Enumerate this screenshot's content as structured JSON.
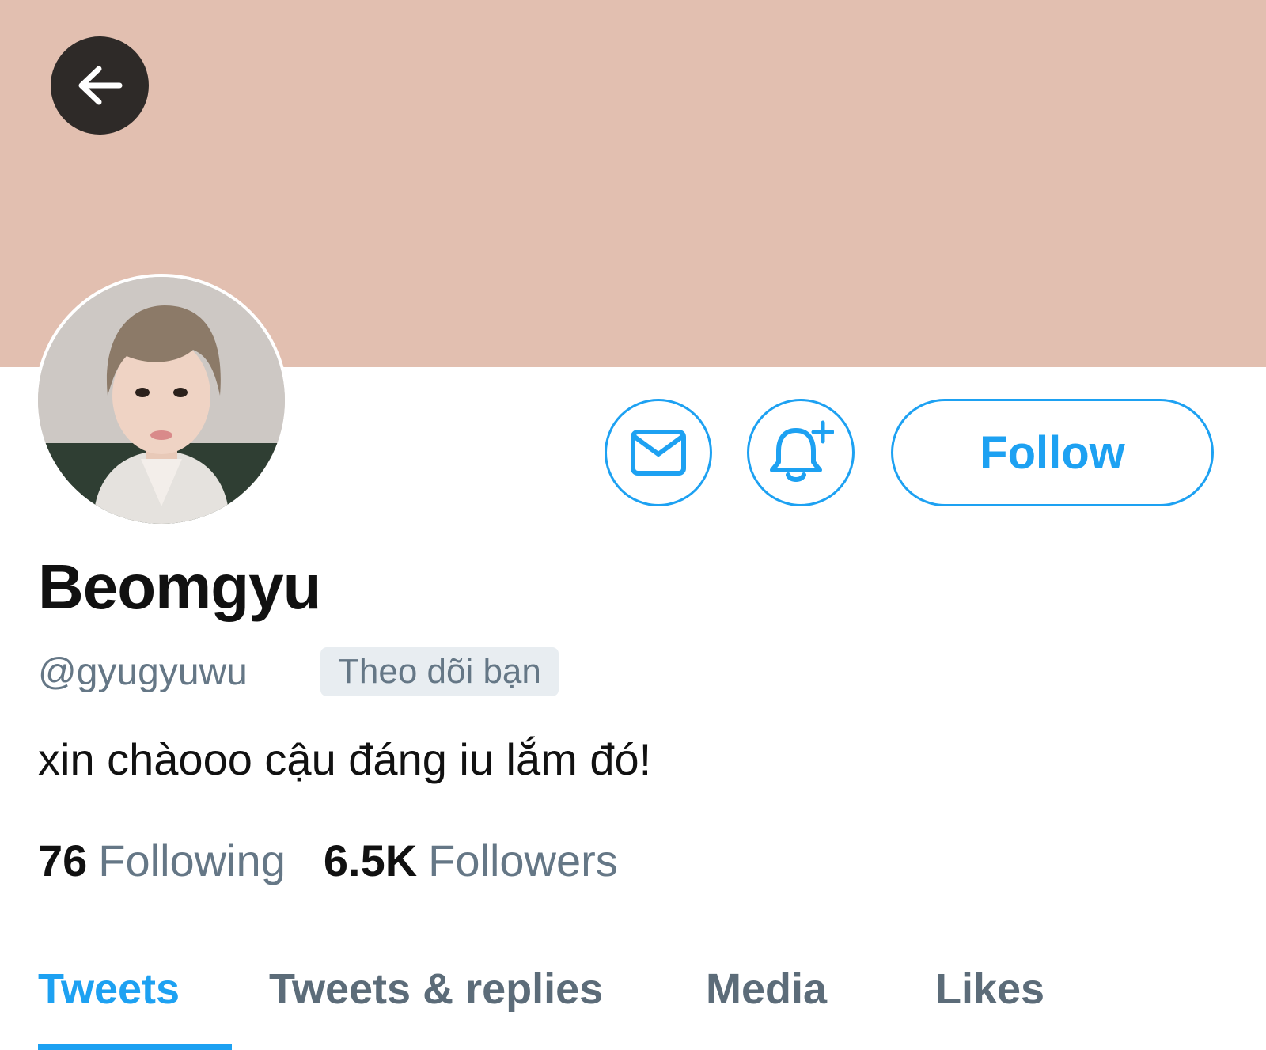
{
  "profile": {
    "display_name": "Beomgyu",
    "handle": "@gyugyuwu",
    "follows_you_badge": "Theo dõi bạn",
    "bio": "xin chàooo cậu đáng iu lắm đó!",
    "following_count": "76",
    "following_label": "Following",
    "followers_count": "6.5K",
    "followers_label": "Followers"
  },
  "actions": {
    "follow_label": "Follow",
    "message_icon": "envelope-icon",
    "notify_icon": "bell-plus-icon",
    "back_icon": "arrow-left-icon"
  },
  "tabs": [
    {
      "label": "Tweets",
      "active": true
    },
    {
      "label": "Tweets & replies",
      "active": false
    },
    {
      "label": "Media",
      "active": false
    },
    {
      "label": "Likes",
      "active": false
    }
  ],
  "colors": {
    "accent": "#1da1f2",
    "banner": "#e2bfb0",
    "secondary_text": "#657786",
    "primary_text": "#111111"
  }
}
